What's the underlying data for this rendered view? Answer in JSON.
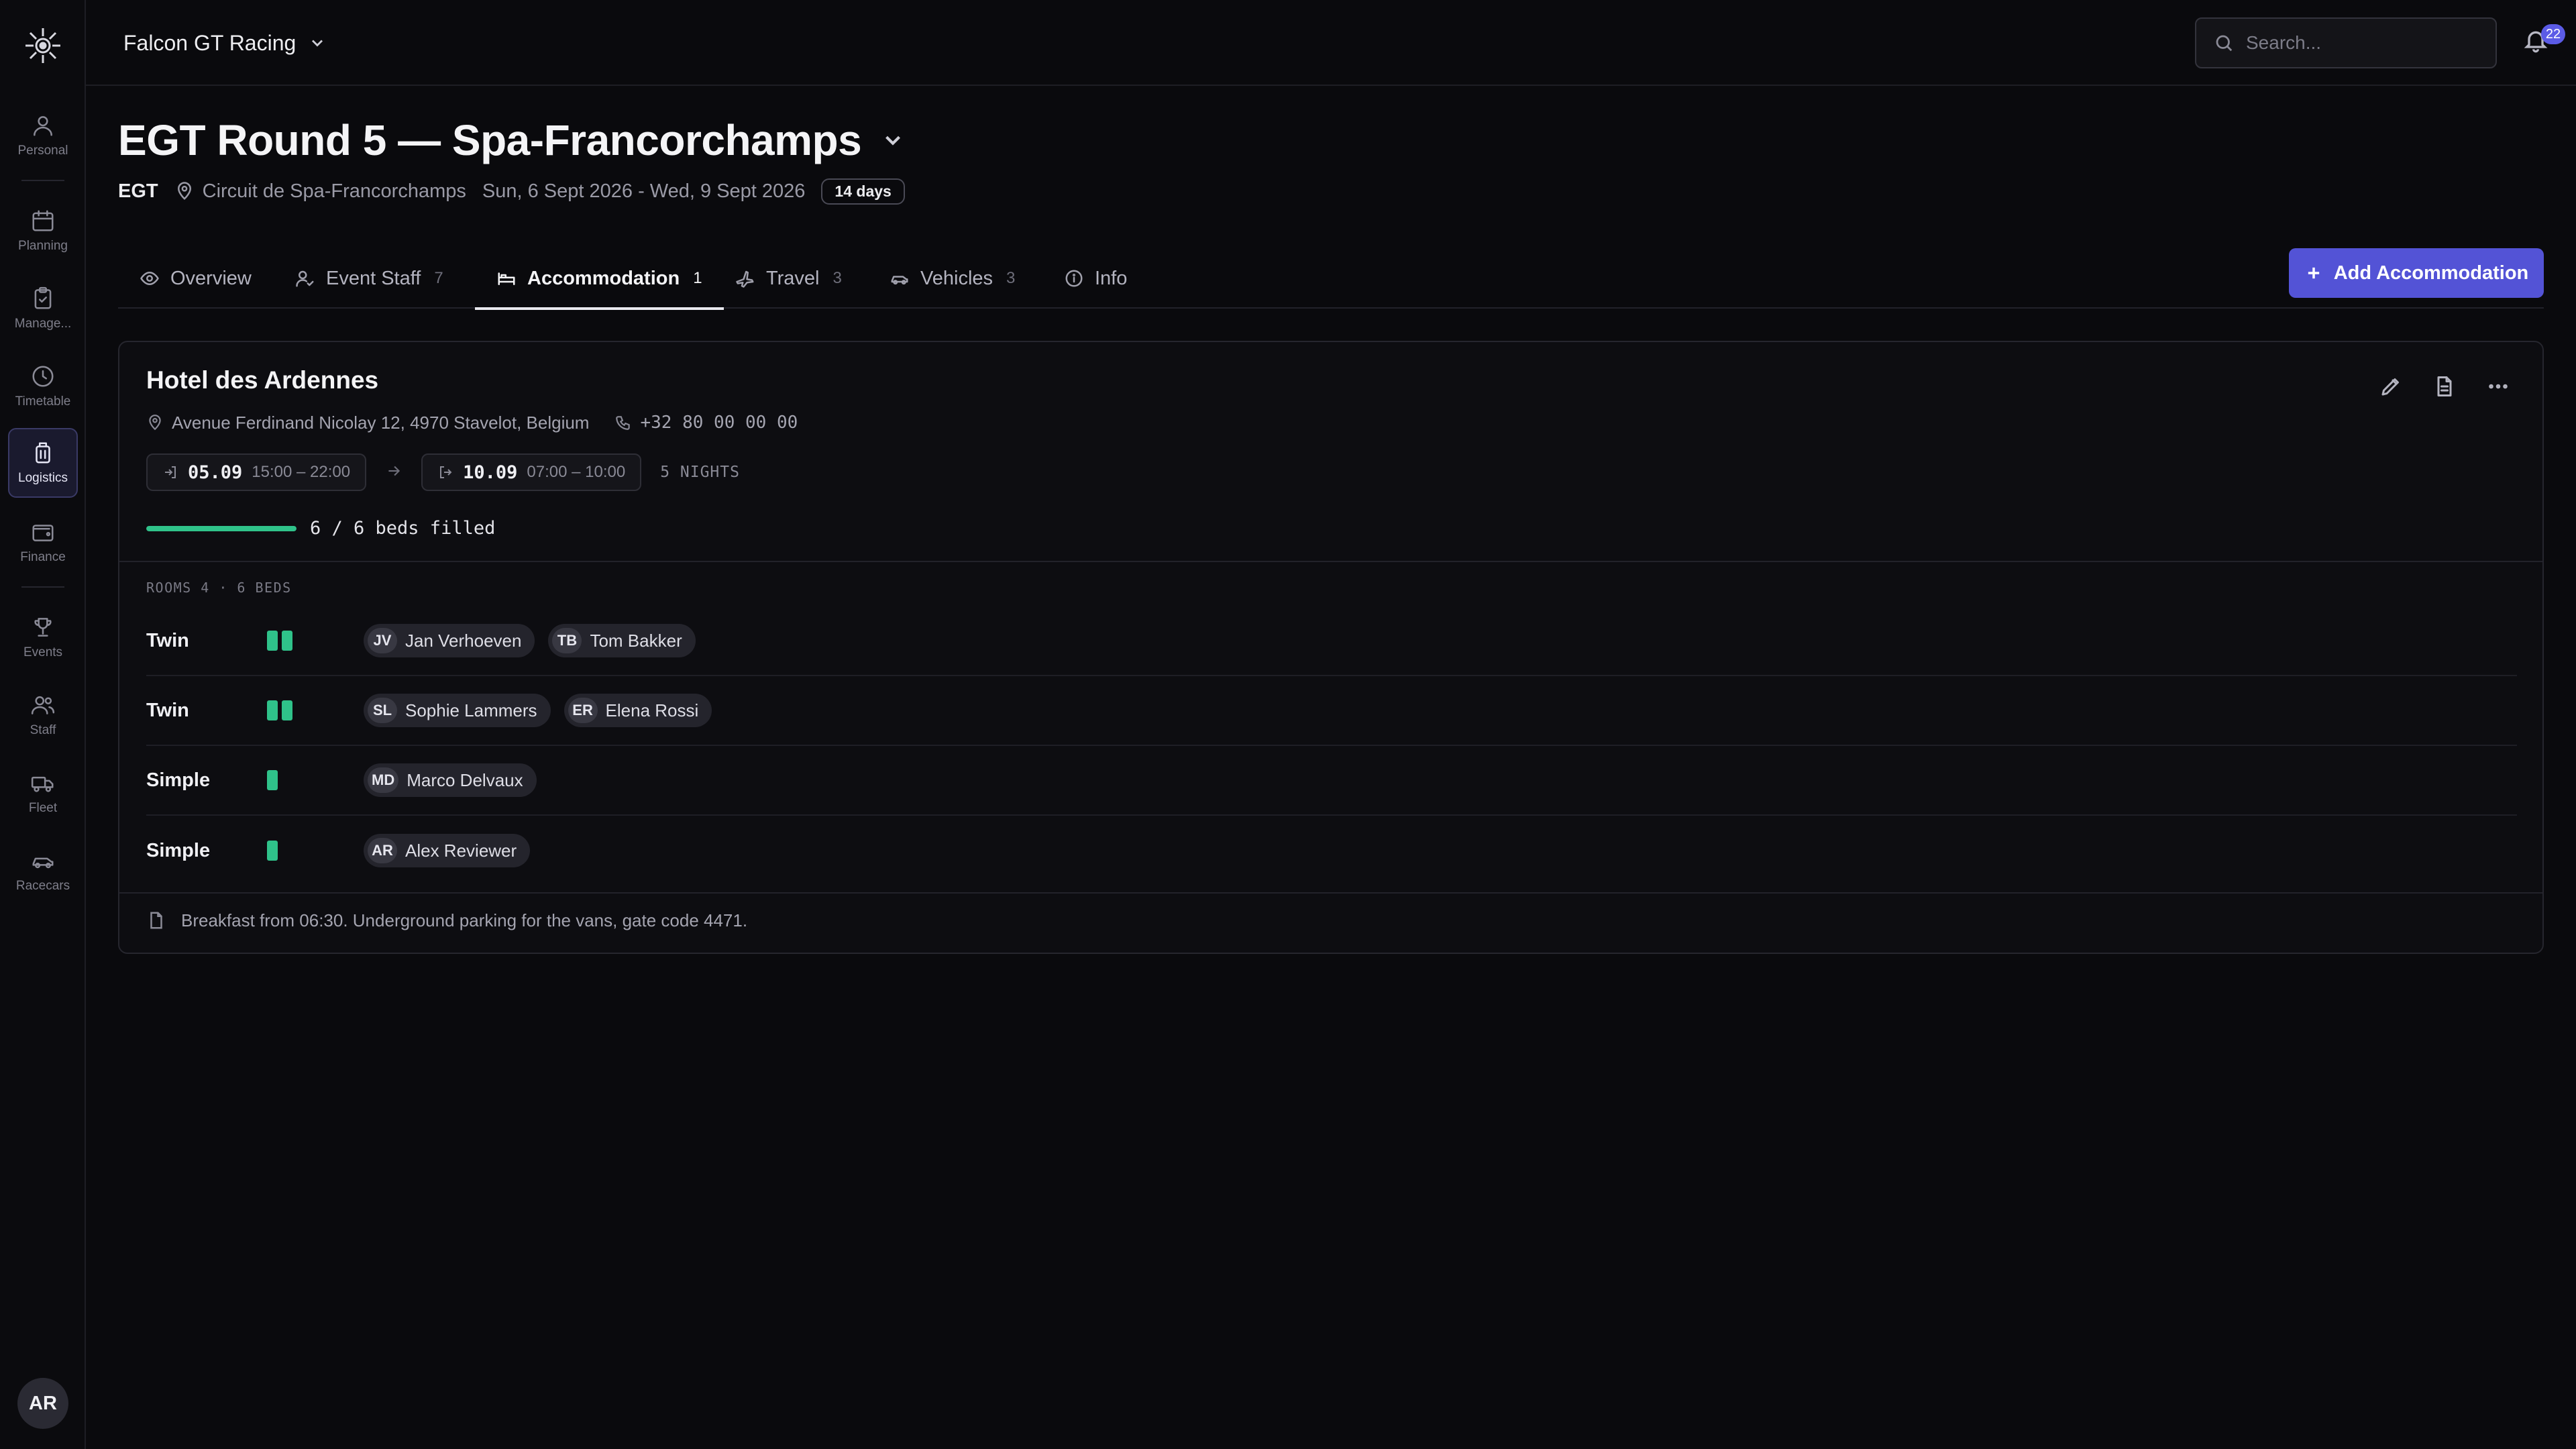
{
  "rail": {
    "items": [
      {
        "label": "Personal",
        "icon": "user-icon"
      },
      {
        "label": "Planning",
        "icon": "calendar-icon"
      },
      {
        "label": "Manage...",
        "icon": "clipboard-icon"
      },
      {
        "label": "Timetable",
        "icon": "clock-icon"
      },
      {
        "label": "Logistics",
        "icon": "luggage-icon",
        "active": true
      },
      {
        "label": "Finance",
        "icon": "wallet-icon"
      },
      {
        "label": "Events",
        "icon": "trophy-icon"
      },
      {
        "label": "Staff",
        "icon": "users-icon"
      },
      {
        "label": "Fleet",
        "icon": "truck-icon"
      },
      {
        "label": "Racecars",
        "icon": "car-icon"
      }
    ],
    "avatar_initials": "AR"
  },
  "topbar": {
    "org_name": "Falcon GT Racing",
    "search_placeholder": "Search...",
    "notifications_count": "22"
  },
  "event": {
    "title": "EGT Round 5 — Spa-Francorchamps",
    "series": "EGT",
    "location": "Circuit de Spa-Francorchamps",
    "dates": "Sun, 6 Sept 2026 - Wed, 9 Sept 2026",
    "duration": "14 days"
  },
  "tabs": [
    {
      "label": "Overview",
      "count": "",
      "icon": "eye-icon"
    },
    {
      "label": "Event Staff",
      "count": "7",
      "icon": "user-check-icon"
    },
    {
      "label": "Accommodation",
      "count": "1",
      "icon": "bed-icon",
      "active": true
    },
    {
      "label": "Travel",
      "count": "3",
      "icon": "plane-icon"
    },
    {
      "label": "Vehicles",
      "count": "3",
      "icon": "car-icon"
    },
    {
      "label": "Info",
      "count": "",
      "icon": "info-icon"
    }
  ],
  "add_button_label": "Add Accommodation",
  "accommodation": {
    "name": "Hotel des Ardennes",
    "address": "Avenue Ferdinand Nicolay 12, 4970 Stavelot, Belgium",
    "phone": "+32 80 00 00 00",
    "check_in": {
      "date": "05.09",
      "time": "15:00 – 22:00"
    },
    "check_out": {
      "date": "10.09",
      "time": "07:00 – 10:00"
    },
    "nights": "5 NIGHTS",
    "beds_filled": 6,
    "beds_total": 6,
    "beds_text": "6 / 6 beds filled",
    "rooms_header": "ROOMS  4 · 6 BEDS",
    "rooms": [
      {
        "type": "Twin",
        "beds": 2,
        "guests": [
          {
            "initials": "JV",
            "name": "Jan Verhoeven"
          },
          {
            "initials": "TB",
            "name": "Tom Bakker"
          }
        ]
      },
      {
        "type": "Twin",
        "beds": 2,
        "guests": [
          {
            "initials": "SL",
            "name": "Sophie Lammers"
          },
          {
            "initials": "ER",
            "name": "Elena Rossi"
          }
        ]
      },
      {
        "type": "Simple",
        "beds": 1,
        "guests": [
          {
            "initials": "MD",
            "name": "Marco Delvaux"
          }
        ]
      },
      {
        "type": "Simple",
        "beds": 1,
        "guests": [
          {
            "initials": "AR",
            "name": "Alex Reviewer"
          }
        ]
      }
    ],
    "note": "Breakfast from 06:30. Underground parking for the vans, gate code 4471."
  },
  "colors": {
    "accent": "#5353d6",
    "success": "#2fc28a",
    "background": "#0a0a0d"
  }
}
